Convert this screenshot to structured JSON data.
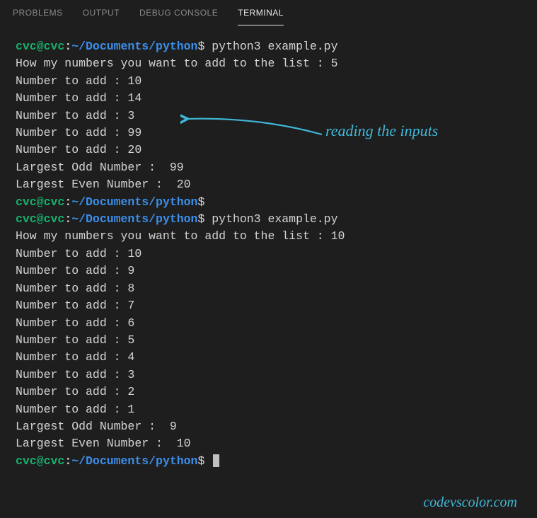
{
  "tabs": {
    "problems": "PROBLEMS",
    "output": "OUTPUT",
    "debug_console": "DEBUG CONSOLE",
    "terminal": "TERMINAL"
  },
  "prompt": {
    "user": "cvc@cvc",
    "colon": ":",
    "path": "~/Documents/python",
    "dollar": "$"
  },
  "run1": {
    "command": " python3 example.py",
    "ask": "How my numbers you want to add to the list : 5",
    "inputs": [
      "Number to add : 10",
      "Number to add : 14",
      "Number to add : 3",
      "Number to add : 99",
      "Number to add : 20"
    ],
    "odd": "Largest Odd Number :  99",
    "even": "Largest Even Number :  20"
  },
  "run2": {
    "command": " python3 example.py",
    "ask": "How my numbers you want to add to the list : 10",
    "inputs": [
      "Number to add : 10",
      "Number to add : 9",
      "Number to add : 8",
      "Number to add : 7",
      "Number to add : 6",
      "Number to add : 5",
      "Number to add : 4",
      "Number to add : 3",
      "Number to add : 2",
      "Number to add : 1"
    ],
    "odd": "Largest Odd Number :  9",
    "even": "Largest Even Number :  10"
  },
  "annotation": {
    "text": "reading the inputs"
  },
  "watermark": "codevscolor.com"
}
